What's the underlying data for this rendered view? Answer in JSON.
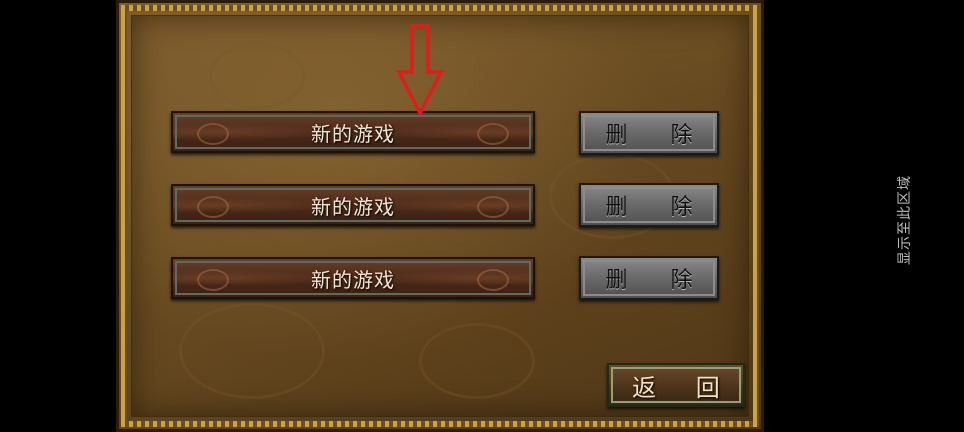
{
  "save_slots": [
    {
      "label": "新的游戏",
      "delete_label": "删 除"
    },
    {
      "label": "新的游戏",
      "delete_label": "删 除"
    },
    {
      "label": "新的游戏",
      "delete_label": "删 除"
    }
  ],
  "back_label": "返 回",
  "side_hint": "显示至此区域",
  "colors": {
    "panel_bg": "#6b4d22",
    "slot_button": "#4a2a19",
    "delete_button": "#6c6c6c",
    "arrow": "#e31b1b",
    "side_text": "#bdbdbd"
  },
  "icons": {
    "annotation": "down-arrow-icon"
  }
}
